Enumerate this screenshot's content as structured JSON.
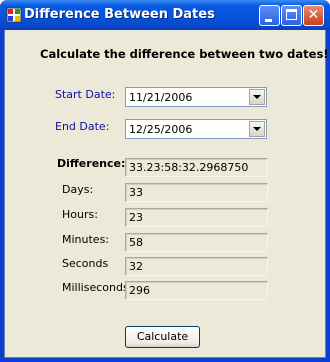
{
  "window": {
    "title": "Difference Between Dates"
  },
  "heading": "Calculate the difference between two dates!",
  "start": {
    "label": "Start Date:",
    "value": "11/21/2006"
  },
  "end": {
    "label": "End Date:",
    "value": "12/25/2006"
  },
  "difference": {
    "label": "Difference:",
    "value": "33.23:58:32.2968750"
  },
  "fields": [
    {
      "label": "Days:",
      "value": "33"
    },
    {
      "label": "Hours:",
      "value": "23"
    },
    {
      "label": "Minutes:",
      "value": "58"
    },
    {
      "label": "Seconds",
      "value": "32"
    },
    {
      "label": "Milliseconds:",
      "value": "296"
    }
  ],
  "calculate_button": "Calculate",
  "icons": {
    "app": "app-window-icon",
    "minimize": "minimize-icon",
    "maximize": "maximize-icon",
    "close": "close-icon",
    "dropdown": "chevron-down-icon"
  },
  "colors": {
    "titlebar": "#0453dd",
    "client_bg": "#ece9d8",
    "label_blue": "#1010a0"
  }
}
